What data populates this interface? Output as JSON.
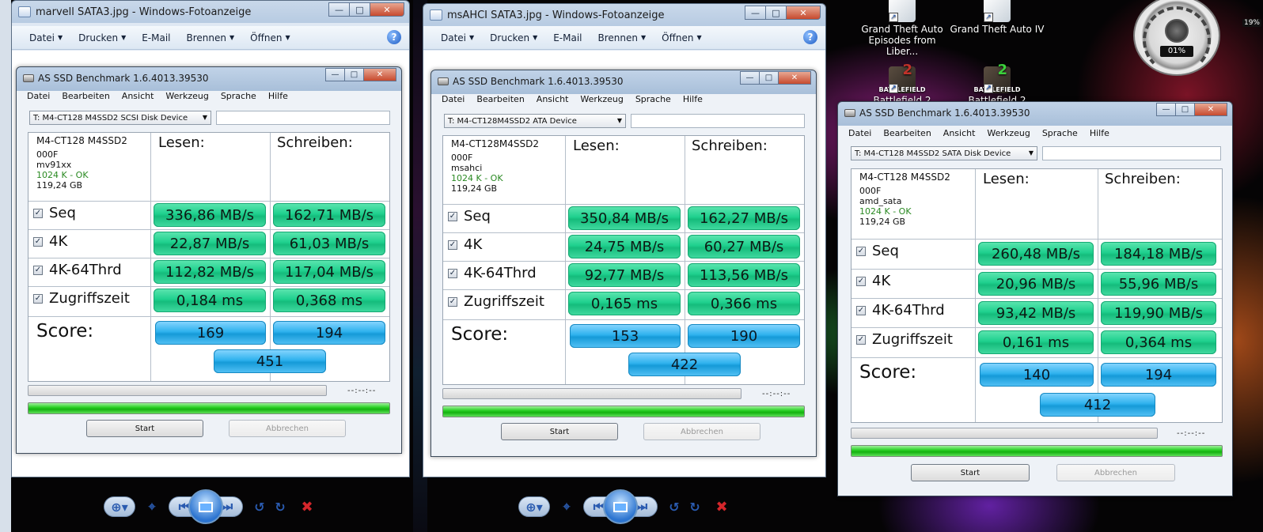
{
  "desktop": {
    "icons": [
      {
        "label_line1": "Grand Theft Auto",
        "label_line2": "Episodes from Liber...",
        "kind": "gta"
      },
      {
        "label_line1": "Grand Theft Auto IV",
        "label_line2": "",
        "kind": "gta"
      },
      {
        "label_line1": "Battlefield 2",
        "label_line2": "",
        "kind": "battlefield"
      },
      {
        "label_line1": "Battlefield 2 Special",
        "label_line2": "",
        "kind": "battlefield"
      }
    ],
    "gadget": {
      "cpu_readout": "01%",
      "mem_readout": "19%"
    }
  },
  "viewers": [
    {
      "title": "marvell SATA3.jpg - Windows-Fotoanzeige",
      "menu": [
        "Datei",
        "Drucken",
        "E-Mail",
        "Brennen",
        "Öffnen"
      ]
    },
    {
      "title": "msAHCI SATA3.jpg - Windows-Fotoanzeige",
      "menu": [
        "Datei",
        "Drucken",
        "E-Mail",
        "Brennen",
        "Öffnen"
      ]
    }
  ],
  "benchmarks": [
    {
      "title": "AS SSD Benchmark 1.6.4013.39530",
      "menu": [
        "Datei",
        "Bearbeiten",
        "Ansicht",
        "Werkzeug",
        "Sprache",
        "Hilfe"
      ],
      "device": "T: M4-CT128 M4SSD2 SCSI Disk Device",
      "info": {
        "model": "M4-CT128 M4SSD2",
        "firmware": "000F",
        "driver": "mv91xx",
        "alignment": "1024 K - OK",
        "size": "119,24 GB"
      },
      "headers": {
        "read": "Lesen:",
        "write": "Schreiben:"
      },
      "rows": [
        {
          "label": "Seq",
          "read": "336,86 MB/s",
          "write": "162,71 MB/s"
        },
        {
          "label": "4K",
          "read": "22,87 MB/s",
          "write": "61,03 MB/s"
        },
        {
          "label": "4K-64Thrd",
          "read": "112,82 MB/s",
          "write": "117,04 MB/s"
        },
        {
          "label": "Zugriffszeit",
          "read": "0,184 ms",
          "write": "0,368 ms"
        }
      ],
      "score": {
        "label": "Score:",
        "read": "169",
        "write": "194",
        "total": "451"
      },
      "time": "--:--:--",
      "buttons": {
        "start": "Start",
        "abort": "Abbrechen"
      }
    },
    {
      "title": "AS SSD Benchmark 1.6.4013.39530",
      "menu": [
        "Datei",
        "Bearbeiten",
        "Ansicht",
        "Werkzeug",
        "Sprache",
        "Hilfe"
      ],
      "device": "T: M4-CT128M4SSD2 ATA Device",
      "info": {
        "model": "M4-CT128M4SSD2",
        "firmware": "000F",
        "driver": "msahci",
        "alignment": "1024 K - OK",
        "size": "119,24 GB"
      },
      "headers": {
        "read": "Lesen:",
        "write": "Schreiben:"
      },
      "rows": [
        {
          "label": "Seq",
          "read": "350,84 MB/s",
          "write": "162,27 MB/s"
        },
        {
          "label": "4K",
          "read": "24,75 MB/s",
          "write": "60,27 MB/s"
        },
        {
          "label": "4K-64Thrd",
          "read": "92,77 MB/s",
          "write": "113,56 MB/s"
        },
        {
          "label": "Zugriffszeit",
          "read": "0,165 ms",
          "write": "0,366 ms"
        }
      ],
      "score": {
        "label": "Score:",
        "read": "153",
        "write": "190",
        "total": "422"
      },
      "time": "--:--:--",
      "buttons": {
        "start": "Start",
        "abort": "Abbrechen"
      }
    },
    {
      "title": "AS SSD Benchmark 1.6.4013.39530",
      "menu": [
        "Datei",
        "Bearbeiten",
        "Ansicht",
        "Werkzeug",
        "Sprache",
        "Hilfe"
      ],
      "device": "T: M4-CT128 M4SSD2 SATA Disk Device",
      "info": {
        "model": "M4-CT128 M4SSD2",
        "firmware": "000F",
        "driver": "amd_sata",
        "alignment": "1024 K - OK",
        "size": "119,24 GB"
      },
      "headers": {
        "read": "Lesen:",
        "write": "Schreiben:"
      },
      "rows": [
        {
          "label": "Seq",
          "read": "260,48 MB/s",
          "write": "184,18 MB/s"
        },
        {
          "label": "4K",
          "read": "20,96 MB/s",
          "write": "55,96 MB/s"
        },
        {
          "label": "4K-64Thrd",
          "read": "93,42 MB/s",
          "write": "119,90 MB/s"
        },
        {
          "label": "Zugriffszeit",
          "read": "0,161 ms",
          "write": "0,364 ms"
        }
      ],
      "score": {
        "label": "Score:",
        "read": "140",
        "write": "194",
        "total": "412"
      },
      "time": "--:--:--",
      "buttons": {
        "start": "Start",
        "abort": "Abbrechen"
      }
    }
  ]
}
